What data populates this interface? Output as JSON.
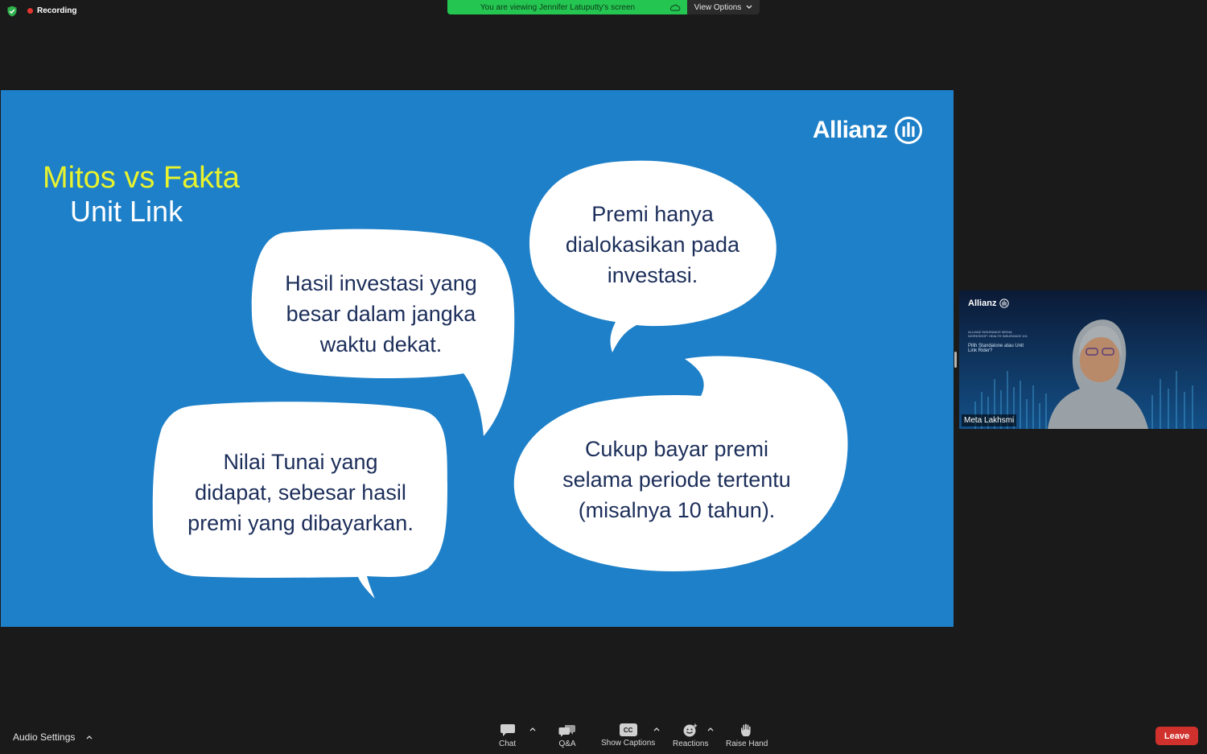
{
  "recording": {
    "label": "Recording"
  },
  "share_banner": {
    "text": "You are viewing Jennifer Latuputty's screen"
  },
  "view_options": {
    "label": "View Options"
  },
  "slide": {
    "brand": "Allianz",
    "title_line1": "Mitos vs Fakta",
    "title_line2": "Unit Link",
    "bubbles": [
      {
        "lines": [
          "Hasil investasi yang",
          "besar dalam jangka",
          "waktu dekat."
        ]
      },
      {
        "lines": [
          "Premi hanya",
          "dialokasikan pada",
          "investasi."
        ]
      },
      {
        "lines": [
          "Nilai Tunai yang",
          "didapat, sebesar hasil",
          "premi yang dibayarkan."
        ]
      },
      {
        "lines": [
          "Cukup bayar premi",
          "selama periode tertentu",
          "(misalnya 10 tahun)."
        ]
      }
    ],
    "colors": {
      "background": "#1e80c8",
      "title_accent": "#e8f32d",
      "bubble_text": "#1c2e5a"
    }
  },
  "participant": {
    "brand": "Allianz",
    "backdrop_small_text": "ALLIANZ INSURANCE MEDIA WORKSHOP: HEALTH INSURANCE 101",
    "backdrop_subtitle": "Pilih Standalone atau Unit Link Rider?",
    "name": "Meta Lakhsmi"
  },
  "toolbar": {
    "audio_settings": "Audio Settings",
    "chat": "Chat",
    "qa": "Q&A",
    "captions": "Show Captions",
    "captions_icon_text": "CC",
    "reactions": "Reactions",
    "raise_hand": "Raise Hand",
    "leave": "Leave"
  }
}
